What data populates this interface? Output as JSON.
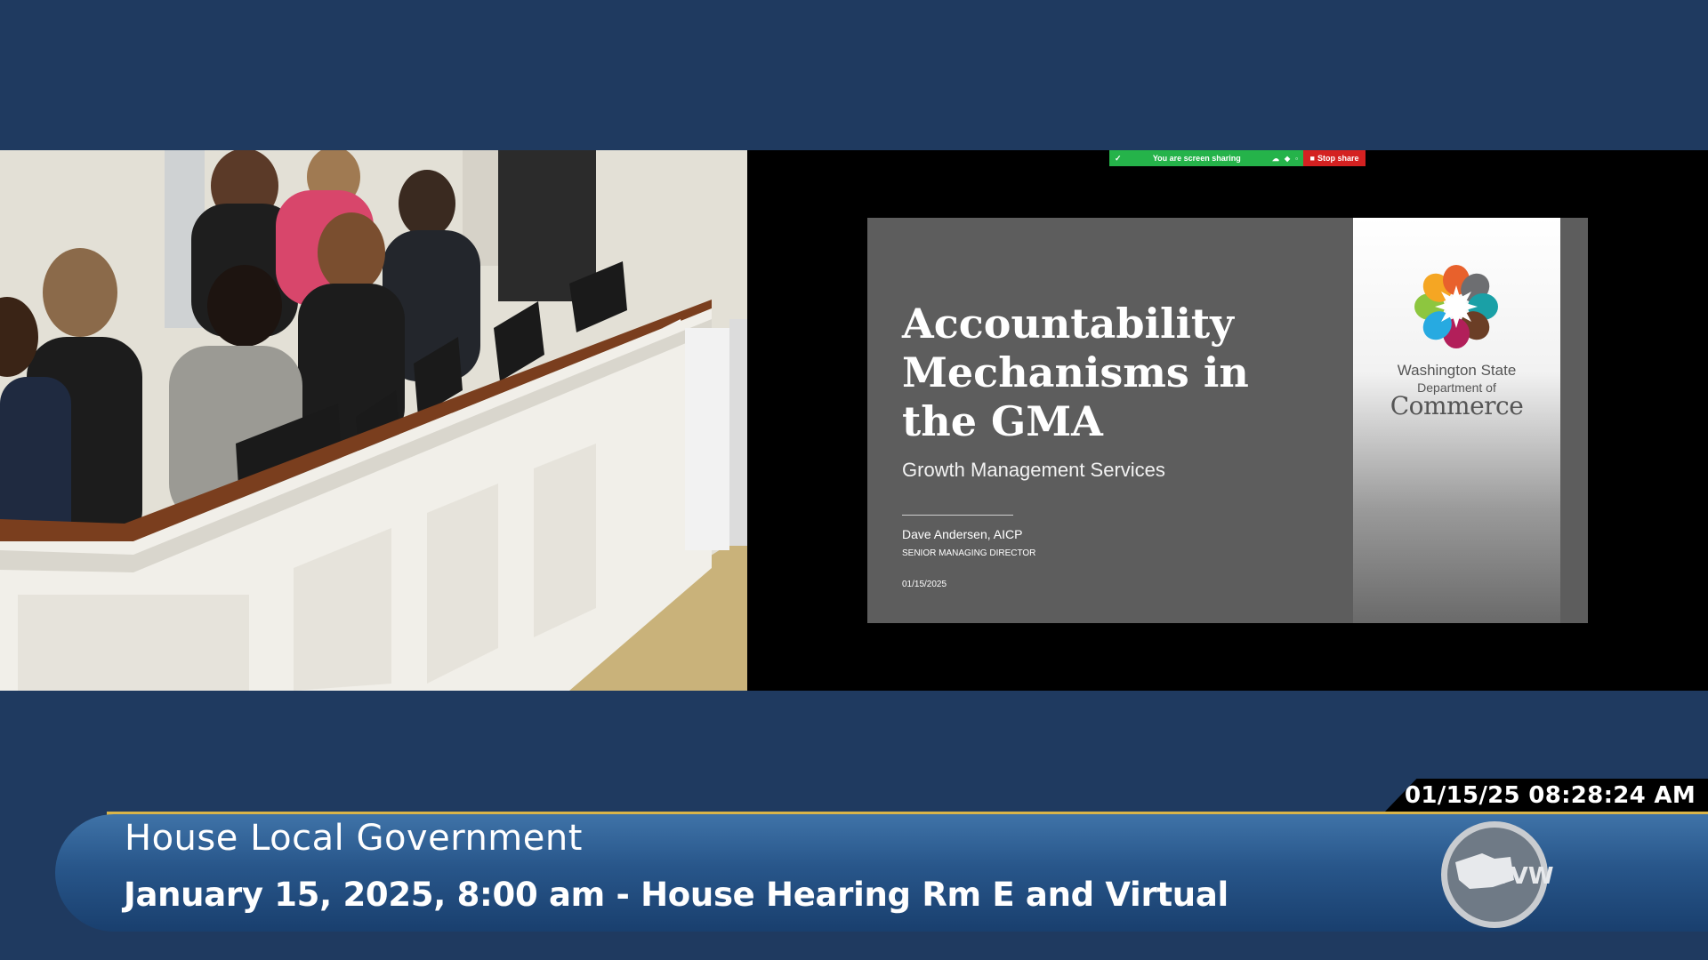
{
  "share_bar": {
    "message": "You are screen sharing",
    "stop_label": "Stop share"
  },
  "slide": {
    "title": "Accountability Mechanisms in the GMA",
    "subtitle": "Growth Management Services",
    "presenter_name": "Dave Andersen, AICP",
    "presenter_role": "SENIOR MANAGING DIRECTOR",
    "date": "01/15/2025",
    "logo": {
      "line1": "Washington State",
      "line2": "Department of",
      "line3": "Commerce",
      "petal_colors": [
        "#8dc63f",
        "#f5a623",
        "#e8612c",
        "#6d6e71",
        "#1aa0a6",
        "#6b3e26",
        "#b21f5a",
        "#27aae1"
      ]
    }
  },
  "broadcast": {
    "timestamp": "01/15/25 08:28:24 AM",
    "committee": "House Local Government",
    "session_info": "January 15, 2025, 8:00 am - House Hearing Rm E and Virtual",
    "network_logo_text": "TVW"
  },
  "colors": {
    "background": "#1f3a60",
    "accent_gold": "#d9b449",
    "share_green": "#25b34a",
    "share_red": "#d42121"
  }
}
